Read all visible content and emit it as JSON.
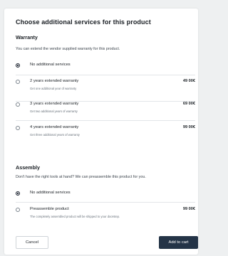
{
  "dialog": {
    "title": "Choose additional services for this product"
  },
  "warranty": {
    "heading": "Warranty",
    "description": "You can extend the vendor supplied warranty for this product.",
    "options": [
      {
        "label": "No additional services",
        "sub": "",
        "price": "",
        "selected": true
      },
      {
        "label": "2 years extended warranty",
        "sub": "Get one additional year of warranty",
        "price": "49 00€",
        "selected": false
      },
      {
        "label": "3 years extended warranty",
        "sub": "Get two additional years of warranty",
        "price": "69 00€",
        "selected": false
      },
      {
        "label": "4 years extended warranty",
        "sub": "Get three additional years of warranty",
        "price": "99 00€",
        "selected": false
      }
    ]
  },
  "assembly": {
    "heading": "Assembly",
    "description": "Don't have the right tools at hand? We can preassemble this product for you.",
    "options": [
      {
        "label": "No additional services",
        "sub": "",
        "price": "",
        "selected": true
      },
      {
        "label": "Preassemble product",
        "sub": "The completely assembled product will be shipped to your doorstep.",
        "price": "99 00€",
        "selected": false
      }
    ]
  },
  "actions": {
    "cancel_label": "Cancel",
    "add_to_cart_label": "Add to cart"
  },
  "colors": {
    "primary_button": "#243447",
    "background": "#eef0f1"
  }
}
